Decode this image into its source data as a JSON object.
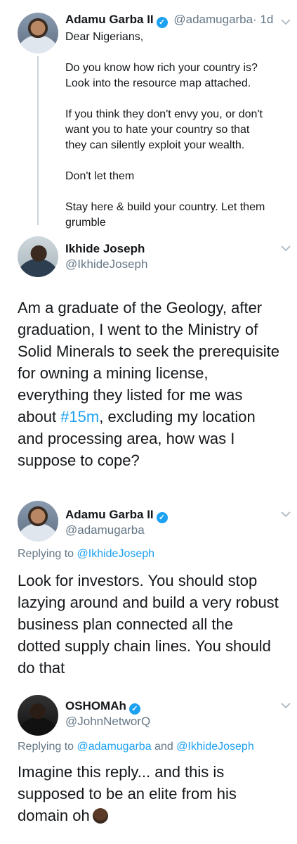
{
  "tweet1": {
    "name": "Adamu Garba II",
    "handle": "@adamugarba",
    "time": "· 1d",
    "lines": [
      "Dear Nigerians,",
      "",
      "Do you know how rich your country is?",
      "Look into the resource map attached.",
      "",
      "If you think they don't envy you, or don't",
      "want you to hate your country so that",
      "they can silently exploit your wealth.",
      "",
      "Don't let them",
      "",
      "Stay here & build your country. Let them",
      "grumble"
    ]
  },
  "tweet2": {
    "name": "Ikhide Joseph",
    "handle": "@IkhideJoseph",
    "lines": [
      "Am a graduate of the Geology, after",
      "graduation, I went to the Ministry of",
      "Solid Minerals to seek the prerequisite",
      "for owning a mining license,",
      "everything they  listed for me was"
    ],
    "line6_pre": "about ",
    "hashtag": "#15m",
    "line6_post": ", excluding my location",
    "lines_end": [
      "and processing area, how was I",
      "suppose to cope?"
    ]
  },
  "tweet3": {
    "name": "Adamu Garba II",
    "handle": "@adamugarba",
    "replying_prefix": "Replying to ",
    "replying_to": "@IkhideJoseph",
    "lines": [
      "Look for investors. You should stop",
      "lazying around and build a very robust",
      "business plan connected all the",
      "dotted supply chain lines. You should",
      "do that"
    ]
  },
  "tweet4": {
    "name": "OSHOMAh",
    "handle": "@JohnNetworQ",
    "replying_prefix": "Replying to ",
    "replying_to_1": "@adamugarba",
    "replying_and": " and ",
    "replying_to_2": "@IkhideJoseph",
    "lines": [
      "Imagine this reply... and this is",
      "supposed to be an elite from his"
    ],
    "last_line": "domain oh"
  },
  "icons": {
    "verified": "verified-badge-icon",
    "menu": "chevron-down-icon"
  },
  "colors": {
    "link": "#1da1f2",
    "muted": "#657786",
    "text": "#14171a"
  }
}
